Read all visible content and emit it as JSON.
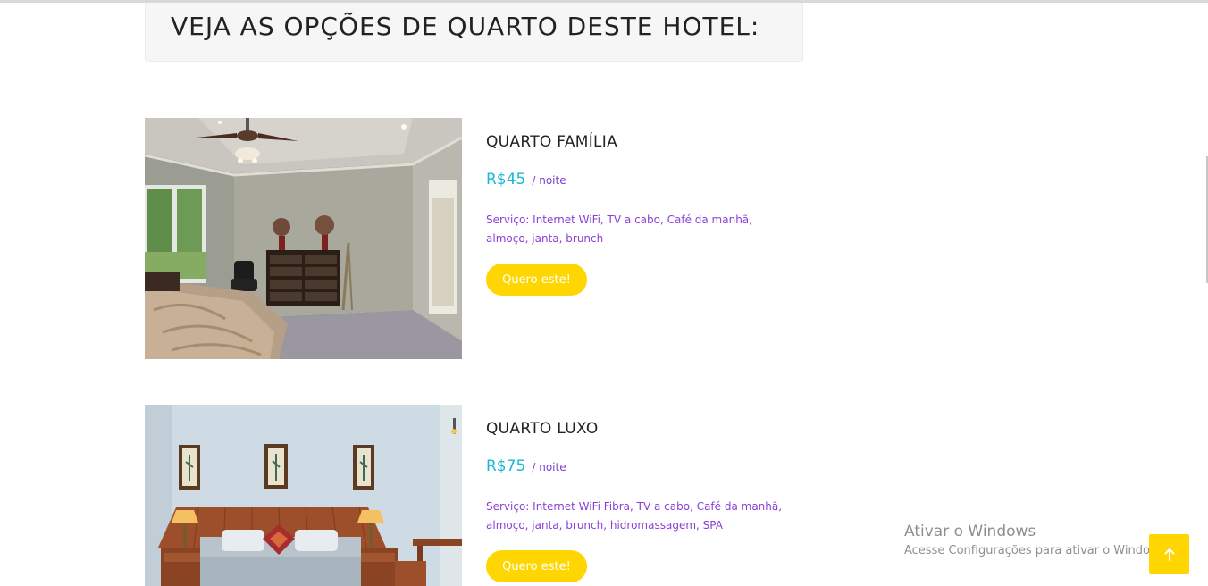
{
  "header": {
    "title": "VEJA AS OPÇÕES DE QUARTO DESTE HOTEL:"
  },
  "rooms": [
    {
      "title": "QUARTO FAMÍLIA",
      "price": "R$45",
      "price_unit": "/ noite",
      "services": "Serviço: Internet WiFi, TV a cabo, Café da manhã, almoço, janta, brunch",
      "button_label": "Quero este!",
      "image_alt": "Quarto família com cama, cômoda e ventilador de teto"
    },
    {
      "title": "QUARTO LUXO",
      "price": "R$75",
      "price_unit": "/ noite",
      "services": "Serviço: Internet WiFi Fibra, TV a cabo, Café da manhã, almoço, janta, brunch, hidromassagem, SPA",
      "button_label": "Quero este!",
      "image_alt": "Quarto luxo com cama de casal, cabeceira de madeira e abajures"
    }
  ],
  "windows_activation": {
    "title": "Ativar o Windows",
    "subtitle": "Acesse Configurações para ativar o Windows."
  },
  "colors": {
    "accent_yellow": "#ffd602",
    "price_cyan": "#1bb8d6",
    "text_purple": "#8a3fd4"
  },
  "icons": {
    "scroll_top": "arrow-up-icon"
  }
}
